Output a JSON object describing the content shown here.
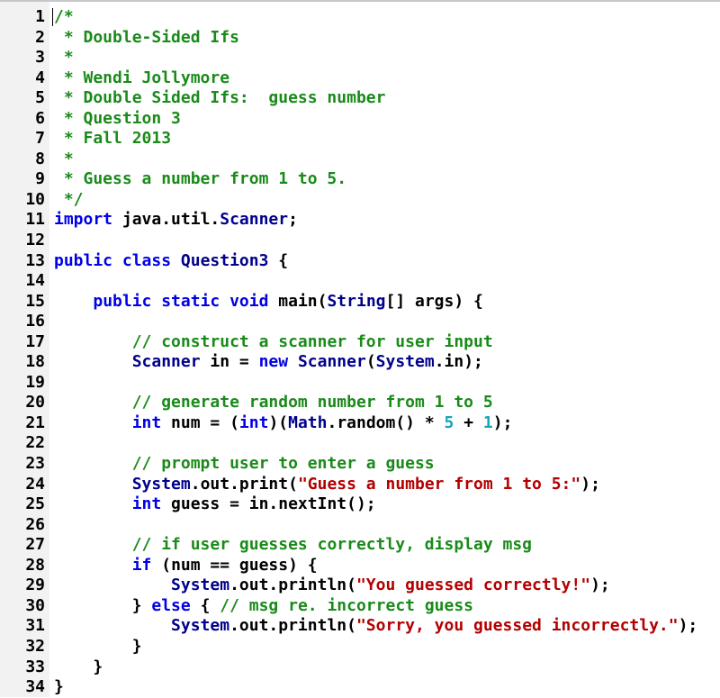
{
  "editor": {
    "cursor_line": 1,
    "colors": {
      "comment": "#1a8a1a",
      "keyword": "#0000e6",
      "type": "#00008b",
      "string": "#b30000",
      "number": "#17a5b5",
      "plain": "#000000",
      "gutter_bg": "#f2f2f2"
    },
    "lines": [
      {
        "n": "1",
        "tokens": [
          [
            "c",
            "/*"
          ]
        ]
      },
      {
        "n": "2",
        "tokens": [
          [
            "c",
            " * Double-Sided Ifs"
          ]
        ]
      },
      {
        "n": "3",
        "tokens": [
          [
            "c",
            " *"
          ]
        ]
      },
      {
        "n": "4",
        "tokens": [
          [
            "c",
            " * Wendi Jollymore"
          ]
        ]
      },
      {
        "n": "5",
        "tokens": [
          [
            "c",
            " * Double Sided Ifs:  guess number"
          ]
        ]
      },
      {
        "n": "6",
        "tokens": [
          [
            "c",
            " * Question 3"
          ]
        ]
      },
      {
        "n": "7",
        "tokens": [
          [
            "c",
            " * Fall 2013"
          ]
        ]
      },
      {
        "n": "8",
        "tokens": [
          [
            "c",
            " *"
          ]
        ]
      },
      {
        "n": "9",
        "tokens": [
          [
            "c",
            " * Guess a number from 1 to 5."
          ]
        ]
      },
      {
        "n": "10",
        "tokens": [
          [
            "c",
            " */"
          ]
        ]
      },
      {
        "n": "11",
        "tokens": [
          [
            "k",
            "import"
          ],
          [
            "p",
            " java.util."
          ],
          [
            "t",
            "Scanner"
          ],
          [
            "p",
            ";"
          ]
        ]
      },
      {
        "n": "12",
        "tokens": []
      },
      {
        "n": "13",
        "tokens": [
          [
            "k",
            "public class"
          ],
          [
            "p",
            " "
          ],
          [
            "t",
            "Question3"
          ],
          [
            "p",
            " {"
          ]
        ]
      },
      {
        "n": "14",
        "tokens": []
      },
      {
        "n": "15",
        "tokens": [
          [
            "p",
            "    "
          ],
          [
            "k",
            "public static void"
          ],
          [
            "p",
            " main("
          ],
          [
            "t",
            "String"
          ],
          [
            "p",
            "[] args) {"
          ]
        ]
      },
      {
        "n": "16",
        "tokens": []
      },
      {
        "n": "17",
        "tokens": [
          [
            "p",
            "        "
          ],
          [
            "c",
            "// construct a scanner for user input"
          ]
        ]
      },
      {
        "n": "18",
        "tokens": [
          [
            "p",
            "        "
          ],
          [
            "t",
            "Scanner"
          ],
          [
            "p",
            " in = "
          ],
          [
            "k",
            "new"
          ],
          [
            "p",
            " "
          ],
          [
            "t",
            "Scanner"
          ],
          [
            "p",
            "("
          ],
          [
            "t",
            "System"
          ],
          [
            "p",
            ".in);"
          ]
        ]
      },
      {
        "n": "19",
        "tokens": []
      },
      {
        "n": "20",
        "tokens": [
          [
            "p",
            "        "
          ],
          [
            "c",
            "// generate random number from 1 to 5"
          ]
        ]
      },
      {
        "n": "21",
        "tokens": [
          [
            "p",
            "        "
          ],
          [
            "k",
            "int"
          ],
          [
            "p",
            " num = ("
          ],
          [
            "k",
            "int"
          ],
          [
            "p",
            ")("
          ],
          [
            "t",
            "Math"
          ],
          [
            "p",
            ".random() * "
          ],
          [
            "n",
            "5"
          ],
          [
            "p",
            " + "
          ],
          [
            "n",
            "1"
          ],
          [
            "p",
            ");"
          ]
        ]
      },
      {
        "n": "22",
        "tokens": []
      },
      {
        "n": "23",
        "tokens": [
          [
            "p",
            "        "
          ],
          [
            "c",
            "// prompt user to enter a guess"
          ]
        ]
      },
      {
        "n": "24",
        "tokens": [
          [
            "p",
            "        "
          ],
          [
            "t",
            "System"
          ],
          [
            "p",
            ".out.print("
          ],
          [
            "s",
            "\"Guess a number from 1 to 5:\""
          ],
          [
            "p",
            ");"
          ]
        ]
      },
      {
        "n": "25",
        "tokens": [
          [
            "p",
            "        "
          ],
          [
            "k",
            "int"
          ],
          [
            "p",
            " guess = in.nextInt();"
          ]
        ]
      },
      {
        "n": "26",
        "tokens": []
      },
      {
        "n": "27",
        "tokens": [
          [
            "p",
            "        "
          ],
          [
            "c",
            "// if user guesses correctly, display msg"
          ]
        ]
      },
      {
        "n": "28",
        "tokens": [
          [
            "p",
            "        "
          ],
          [
            "k",
            "if"
          ],
          [
            "p",
            " (num == guess) {"
          ]
        ]
      },
      {
        "n": "29",
        "tokens": [
          [
            "p",
            "            "
          ],
          [
            "t",
            "System"
          ],
          [
            "p",
            ".out.println("
          ],
          [
            "s",
            "\"You guessed correctly!\""
          ],
          [
            "p",
            ");"
          ]
        ]
      },
      {
        "n": "30",
        "tokens": [
          [
            "p",
            "        } "
          ],
          [
            "k",
            "else"
          ],
          [
            "p",
            " { "
          ],
          [
            "c",
            "// msg re. incorrect guess"
          ]
        ]
      },
      {
        "n": "31",
        "tokens": [
          [
            "p",
            "            "
          ],
          [
            "t",
            "System"
          ],
          [
            "p",
            ".out.println("
          ],
          [
            "s",
            "\"Sorry, you guessed incorrectly.\""
          ],
          [
            "p",
            ");"
          ]
        ]
      },
      {
        "n": "32",
        "tokens": [
          [
            "p",
            "        }"
          ]
        ]
      },
      {
        "n": "33",
        "tokens": [
          [
            "p",
            "    }"
          ]
        ]
      },
      {
        "n": "34",
        "tokens": [
          [
            "p",
            "}"
          ]
        ]
      }
    ]
  }
}
